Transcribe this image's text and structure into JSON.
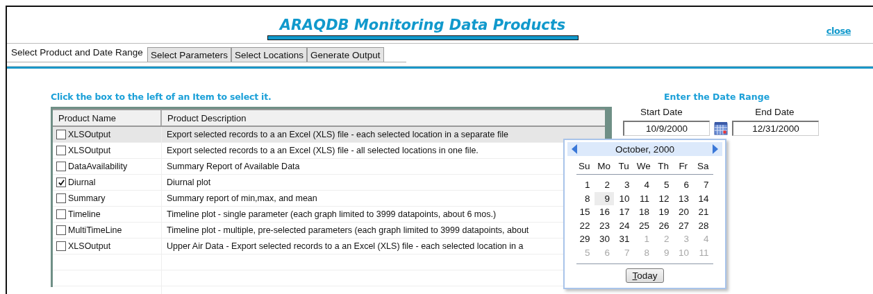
{
  "window": {
    "title": "ARAQDB Monitoring Data Products",
    "close_link": "close"
  },
  "tabs": [
    {
      "label": "Select Product and Date Range",
      "selected": true
    },
    {
      "label": "Select Parameters",
      "selected": false
    },
    {
      "label": "Select Locations",
      "selected": false
    },
    {
      "label": "Generate Output",
      "selected": false
    }
  ],
  "instruction": "Click the box to the left of an Item to select it.",
  "table": {
    "columns": [
      "Product Name",
      "Product Description"
    ],
    "rows": [
      {
        "name": "XLSOutput",
        "description": "Export selected records to a an Excel (XLS) file  - each selected location in a separate file",
        "checked": false,
        "selected": true
      },
      {
        "name": "XLSOutput",
        "description": "Export selected records to a an Excel (XLS) file  - all selected locations in one file.",
        "checked": false,
        "selected": false
      },
      {
        "name": "DataAvailability",
        "description": "Summary Report of Available Data",
        "checked": false,
        "selected": false
      },
      {
        "name": "Diurnal",
        "description": "Diurnal plot",
        "checked": true,
        "selected": false
      },
      {
        "name": "Summary",
        "description": "Summary report of min,max, and mean",
        "checked": false,
        "selected": false
      },
      {
        "name": "Timeline",
        "description": "Timeline plot - single parameter (each graph limited to 3999 datapoints, about 6 mos.)",
        "checked": false,
        "selected": false
      },
      {
        "name": "MultiTimeLine",
        "description": "Timeline plot - multiple, pre-selected parameters (each graph limited to 3999 datapoints, about",
        "checked": false,
        "selected": false
      },
      {
        "name": "XLSOutput",
        "description": "Upper Air Data - Export selected records to a an Excel (XLS) file  - each selected location in a",
        "checked": false,
        "selected": false
      }
    ]
  },
  "date_range": {
    "heading": "Enter the Date Range",
    "start_label": "Start Date",
    "start_value": "10/9/2000",
    "end_label": "End Date",
    "end_value": "12/31/2000"
  },
  "calendar": {
    "month_title": "October, 2000",
    "weekdays": [
      "Su",
      "Mo",
      "Tu",
      "We",
      "Th",
      "Fr",
      "Sa"
    ],
    "weeks": [
      [
        {
          "day": "1",
          "other_month": false,
          "selected": false
        },
        {
          "day": "2",
          "other_month": false,
          "selected": false
        },
        {
          "day": "3",
          "other_month": false,
          "selected": false
        },
        {
          "day": "4",
          "other_month": false,
          "selected": false
        },
        {
          "day": "5",
          "other_month": false,
          "selected": false
        },
        {
          "day": "6",
          "other_month": false,
          "selected": false
        },
        {
          "day": "7",
          "other_month": false,
          "selected": false
        }
      ],
      [
        {
          "day": "8",
          "other_month": false,
          "selected": false
        },
        {
          "day": "9",
          "other_month": false,
          "selected": true
        },
        {
          "day": "10",
          "other_month": false,
          "selected": false
        },
        {
          "day": "11",
          "other_month": false,
          "selected": false
        },
        {
          "day": "12",
          "other_month": false,
          "selected": false
        },
        {
          "day": "13",
          "other_month": false,
          "selected": false
        },
        {
          "day": "14",
          "other_month": false,
          "selected": false
        }
      ],
      [
        {
          "day": "15",
          "other_month": false,
          "selected": false
        },
        {
          "day": "16",
          "other_month": false,
          "selected": false
        },
        {
          "day": "17",
          "other_month": false,
          "selected": false
        },
        {
          "day": "18",
          "other_month": false,
          "selected": false
        },
        {
          "day": "19",
          "other_month": false,
          "selected": false
        },
        {
          "day": "20",
          "other_month": false,
          "selected": false
        },
        {
          "day": "21",
          "other_month": false,
          "selected": false
        }
      ],
      [
        {
          "day": "22",
          "other_month": false,
          "selected": false
        },
        {
          "day": "23",
          "other_month": false,
          "selected": false
        },
        {
          "day": "24",
          "other_month": false,
          "selected": false
        },
        {
          "day": "25",
          "other_month": false,
          "selected": false
        },
        {
          "day": "26",
          "other_month": false,
          "selected": false
        },
        {
          "day": "27",
          "other_month": false,
          "selected": false
        },
        {
          "day": "28",
          "other_month": false,
          "selected": false
        }
      ],
      [
        {
          "day": "29",
          "other_month": false,
          "selected": false
        },
        {
          "day": "30",
          "other_month": false,
          "selected": false
        },
        {
          "day": "31",
          "other_month": false,
          "selected": false
        },
        {
          "day": "1",
          "other_month": true,
          "selected": false
        },
        {
          "day": "2",
          "other_month": true,
          "selected": false
        },
        {
          "day": "3",
          "other_month": true,
          "selected": false
        },
        {
          "day": "4",
          "other_month": true,
          "selected": false
        }
      ],
      [
        {
          "day": "5",
          "other_month": true,
          "selected": false
        },
        {
          "day": "6",
          "other_month": true,
          "selected": false
        },
        {
          "day": "7",
          "other_month": true,
          "selected": false
        },
        {
          "day": "8",
          "other_month": true,
          "selected": false
        },
        {
          "day": "9",
          "other_month": true,
          "selected": false
        },
        {
          "day": "10",
          "other_month": true,
          "selected": false
        },
        {
          "day": "11",
          "other_month": true,
          "selected": false
        }
      ]
    ],
    "today_button": "Today"
  }
}
